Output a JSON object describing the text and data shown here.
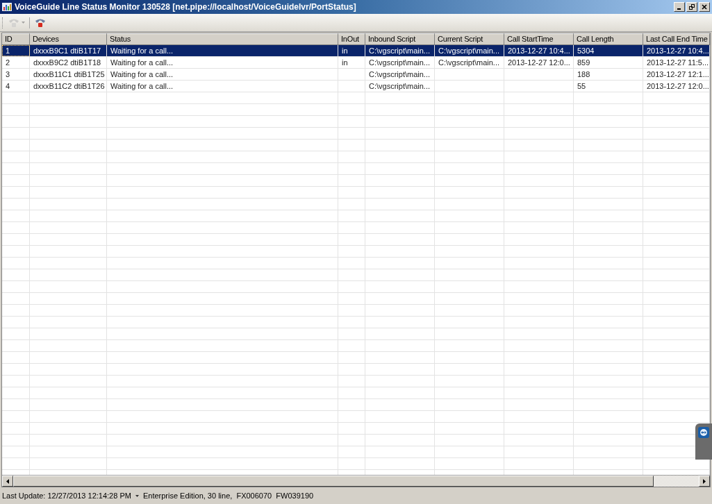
{
  "window": {
    "title": "VoiceGuide Line Status Monitor 130528 [net.pipe://localhost/VoiceGuideIvr/PortStatus]"
  },
  "toolbar": {
    "items": [
      {
        "kind": "dropdown",
        "disabled": true
      },
      {
        "kind": "button",
        "disabled": false
      }
    ]
  },
  "table": {
    "columns": [
      "ID",
      "Devices",
      "Status",
      "InOut",
      "Inbound Script",
      "Current Script",
      "Call StartTime",
      "Call Length",
      "Last Call End Time"
    ],
    "rows": [
      {
        "selected": true,
        "cells": [
          "1",
          "dxxxB9C1 dtiB1T17",
          "Waiting for a call...",
          "in",
          "C:\\vgscript\\main...",
          "C:\\vgscript\\main...",
          "2013-12-27 10:4...",
          "5304",
          "2013-12-27 10:4..."
        ]
      },
      {
        "selected": false,
        "cells": [
          "2",
          "dxxxB9C2 dtiB1T18",
          "Waiting for a call...",
          "in",
          "C:\\vgscript\\main...",
          "C:\\vgscript\\main...",
          "2013-12-27 12:0...",
          "859",
          "2013-12-27 11:5..."
        ]
      },
      {
        "selected": false,
        "cells": [
          "3",
          "dxxxB11C1 dtiB1T25",
          "Waiting for a call...",
          "",
          "C:\\vgscript\\main...",
          "",
          "",
          "188",
          "2013-12-27 12:1..."
        ]
      },
      {
        "selected": false,
        "cells": [
          "4",
          "dxxxB11C2 dtiB1T26",
          "Waiting for a call...",
          "",
          "C:\\vgscript\\main...",
          "",
          "",
          "55",
          "2013-12-27 12:0..."
        ]
      }
    ]
  },
  "status_bar": {
    "last_update": "Last Update: 12/27/2013 12:14:28 PM",
    "edition": "Enterprise Edition, 30 line,  FX006070  FW039190"
  }
}
